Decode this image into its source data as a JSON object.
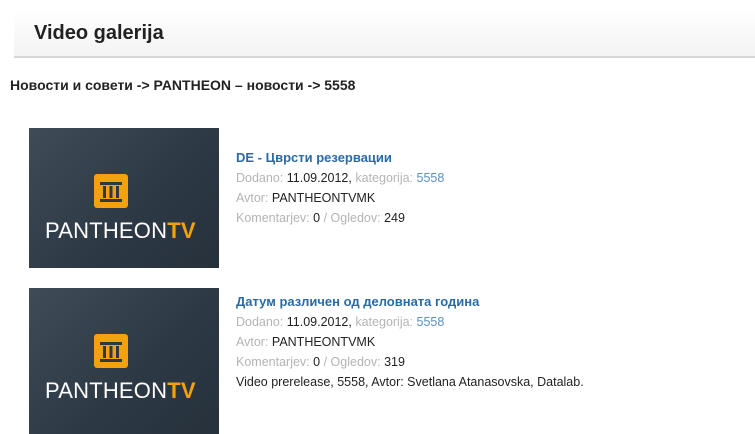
{
  "header": {
    "title": "Video galerija"
  },
  "breadcrumb": "Новости и совети -> PANTHEON – новости -> 5558",
  "labels": {
    "added": "Dodano:",
    "category": "kategorija:",
    "author": "Avtor:",
    "comments": "Komentarjev:",
    "views": "Ogledov:",
    "brand": "PANTHEON",
    "brand_suffix": "TV"
  },
  "videos": [
    {
      "title": "DE - Цврсти резервации",
      "date": "11.09.2012",
      "category": "5558",
      "author": "PANTHEONTVMK",
      "comments": "0",
      "views": "249",
      "description": ""
    },
    {
      "title": "Датум различен од деловната година",
      "date": "11.09.2012",
      "category": "5558",
      "author": "PANTHEONTVMK",
      "comments": "0",
      "views": "319",
      "description": "Video prerelease, 5558, Avtor: Svetlana Atanasovska, Datalab."
    }
  ],
  "colors": {
    "link": "#2a6aa5",
    "category_link": "#5a8fc2",
    "brand_accent": "#f2a20c",
    "thumbnail_bg": "#2c3844"
  }
}
